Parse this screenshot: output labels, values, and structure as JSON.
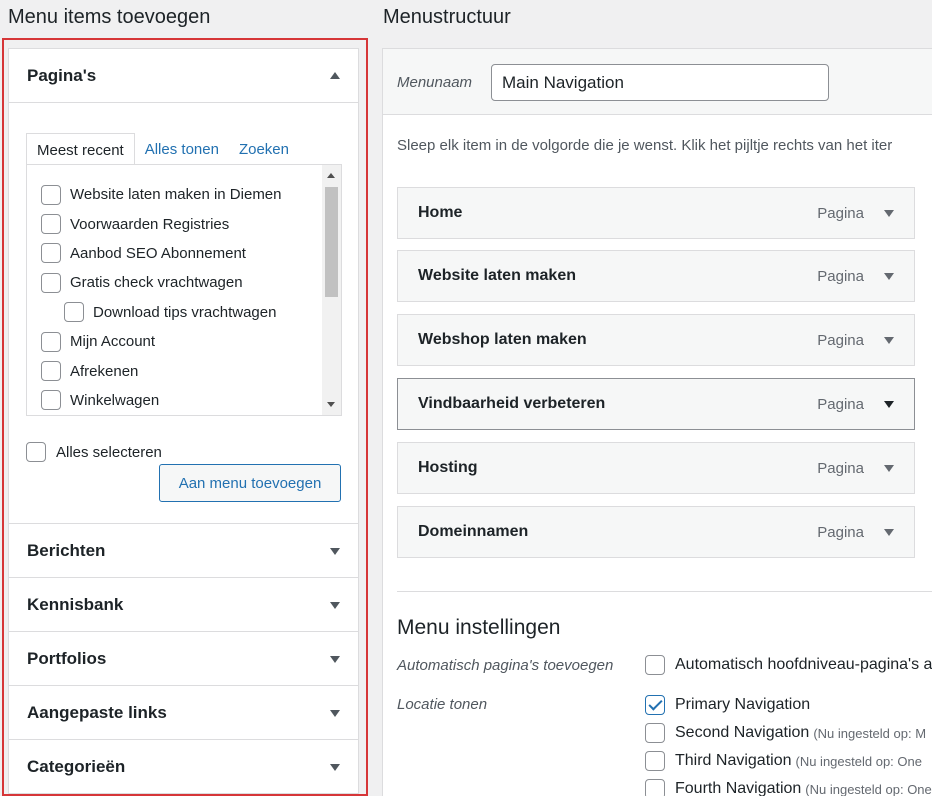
{
  "left": {
    "heading": "Menu items toevoegen",
    "pages_panel": {
      "title": "Pagina's",
      "tabs": [
        "Meest recent",
        "Alles tonen",
        "Zoeken"
      ],
      "items": [
        {
          "label": "Website laten maken in Diemen",
          "level": 0
        },
        {
          "label": "Voorwaarden Registries",
          "level": 0
        },
        {
          "label": "Aanbod SEO Abonnement",
          "level": 0
        },
        {
          "label": "Gratis check vrachtwagen",
          "level": 0
        },
        {
          "label": "Download tips vrachtwagen",
          "level": 1
        },
        {
          "label": "Mijn Account",
          "level": 0
        },
        {
          "label": "Afrekenen",
          "level": 0
        },
        {
          "label": "Winkelwagen",
          "level": 0
        }
      ],
      "select_all": "Alles selecteren",
      "add_button": "Aan menu toevoegen"
    },
    "accordions": [
      "Berichten",
      "Kennisbank",
      "Portfolios",
      "Aangepaste links",
      "Categorieën"
    ]
  },
  "right": {
    "heading": "Menustructuur",
    "name_label": "Menunaam",
    "name_value": "Main Navigation",
    "instructions": "Sleep elk item in de volgorde die je wenst. Klik het pijltje rechts van het iter",
    "menu_items": [
      {
        "title": "Home",
        "type": "Pagina"
      },
      {
        "title": "Website laten maken",
        "type": "Pagina"
      },
      {
        "title": "Webshop laten maken",
        "type": "Pagina"
      },
      {
        "title": "Vindbaarheid verbeteren",
        "type": "Pagina"
      },
      {
        "title": "Hosting",
        "type": "Pagina"
      },
      {
        "title": "Domeinnamen",
        "type": "Pagina"
      }
    ],
    "settings": {
      "title": "Menu instellingen",
      "auto_label": "Automatisch pagina's toevoegen",
      "auto_option": "Automatisch hoofdniveau-pagina's a",
      "location_label": "Locatie tonen",
      "locations": [
        {
          "label": "Primary Navigation",
          "checked": true,
          "note": ""
        },
        {
          "label": "Second Navigation",
          "checked": false,
          "note": "(Nu ingesteld op: M"
        },
        {
          "label": "Third Navigation",
          "checked": false,
          "note": "(Nu ingesteld op: One"
        },
        {
          "label": "Fourth Navigation",
          "checked": false,
          "note": "(Nu ingesteld op: One"
        }
      ]
    }
  },
  "colors": {
    "highlight": "#d63638",
    "link": "#2271b1"
  }
}
